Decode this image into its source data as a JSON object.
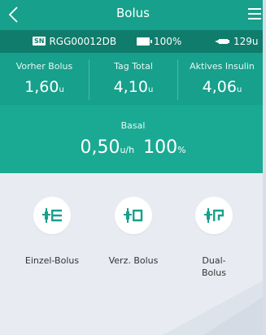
{
  "header": {
    "title": "Bolus",
    "back_icon": "chevron-left-icon",
    "menu_icon": "hamburger-menu-icon"
  },
  "device": {
    "sn_badge": "SN",
    "serial": "RGG00012DB",
    "battery": "100%",
    "insulin": "129u"
  },
  "stats": [
    {
      "label": "Vorher Bolus",
      "value": "1,60",
      "unit": "u"
    },
    {
      "label": "Tag Total",
      "value": "4,10",
      "unit": "u"
    },
    {
      "label": "Aktives Insulin",
      "value": "4,06",
      "unit": "u"
    }
  ],
  "basal": {
    "label": "Basal",
    "rate": "0,50",
    "rate_unit": "u/h",
    "percent": "100",
    "percent_unit": "%"
  },
  "bolus_types": [
    {
      "label": "Einzel-Bolus",
      "icon": "normal-bolus-icon"
    },
    {
      "label": "Verz. Bolus",
      "icon": "extended-bolus-icon"
    },
    {
      "label": "Dual-\nBolus",
      "icon": "dual-bolus-icon"
    }
  ],
  "colors": {
    "primary": "#17a08c",
    "dark": "#0f7c6c",
    "basal": "#1aaa93",
    "background": "#e8ecf2",
    "accent_icon": "#17a08c"
  }
}
